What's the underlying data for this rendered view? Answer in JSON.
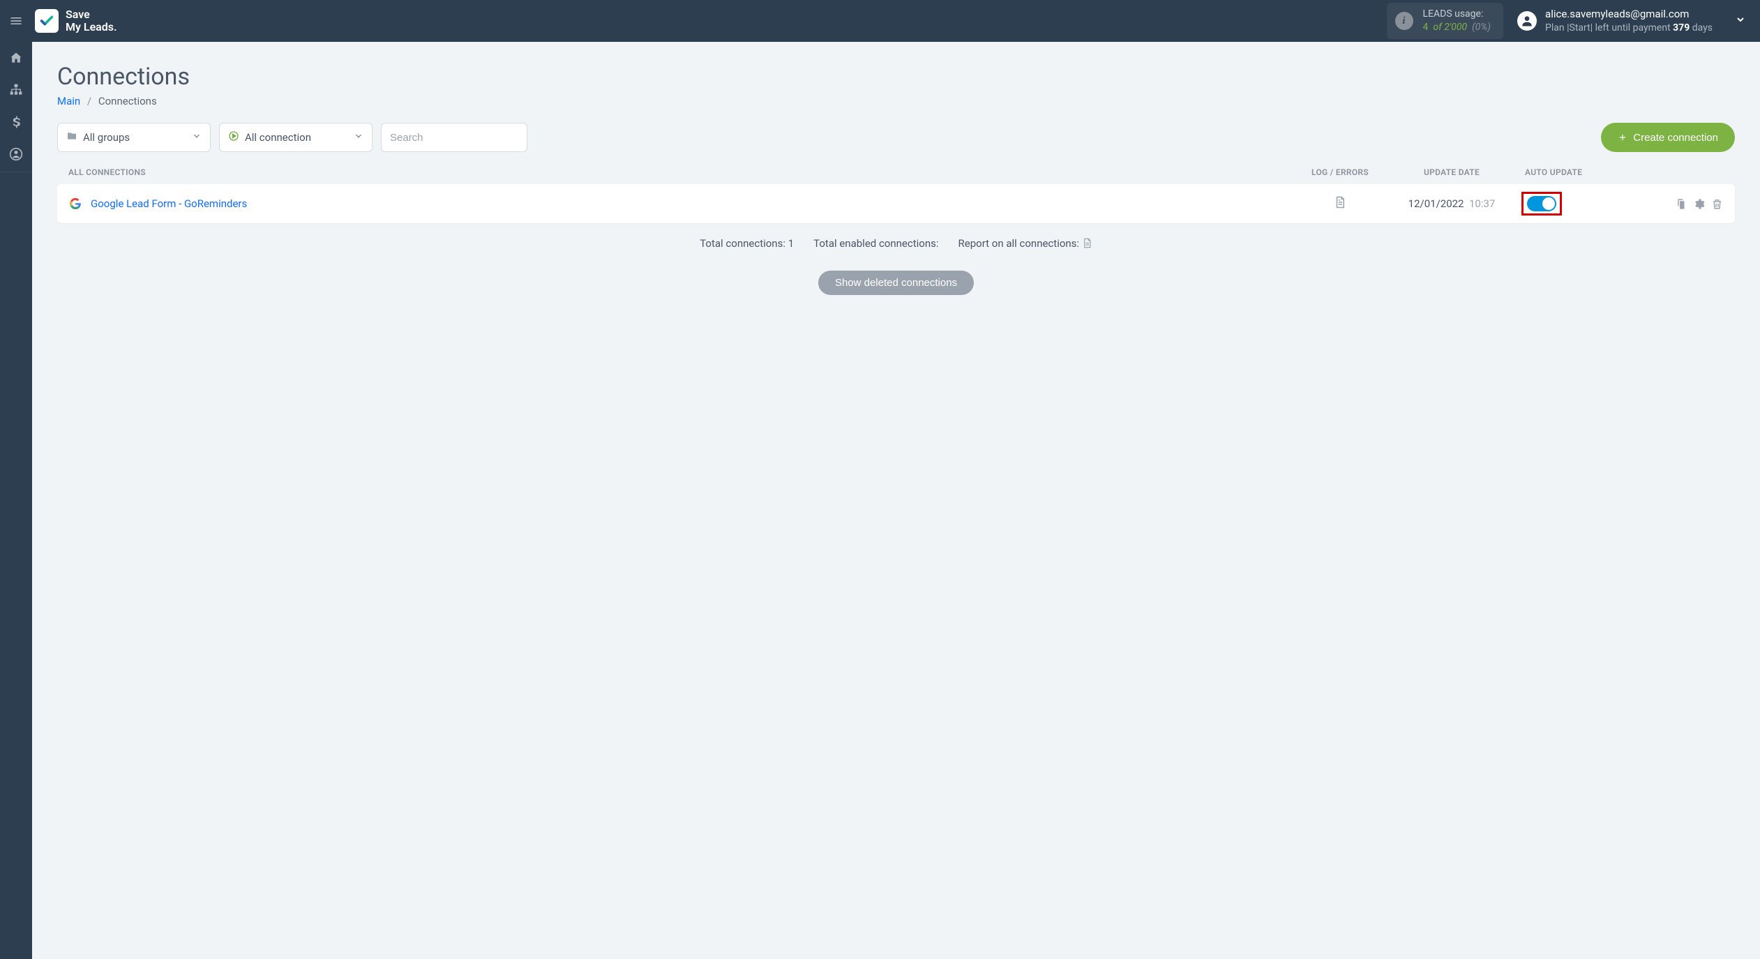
{
  "brand": {
    "line1": "Save",
    "line2": "My Leads."
  },
  "usage": {
    "label": "LEADS usage:",
    "count": "4",
    "of": "of",
    "limit": "2'000",
    "pct": "(0%)"
  },
  "account": {
    "email": "alice.savemyleads@gmail.com",
    "plan_prefix": "Plan |Start| left until payment",
    "days_num": "379",
    "days_suffix": "days"
  },
  "page": {
    "title": "Connections",
    "breadcrumb_main": "Main",
    "breadcrumb_current": "Connections"
  },
  "filters": {
    "groups": "All groups",
    "status": "All connection",
    "search_placeholder": "Search",
    "create_label": "Create connection"
  },
  "columns": {
    "name": "ALL CONNECTIONS",
    "log": "LOG / ERRORS",
    "date": "UPDATE DATE",
    "auto": "AUTO UPDATE"
  },
  "connections": [
    {
      "name": "Google Lead Form - GoReminders",
      "date": "12/01/2022",
      "time": "10:37",
      "enabled": true
    }
  ],
  "summary": {
    "total_label": "Total connections:",
    "total_value": "1",
    "enabled_label": "Total enabled connections:",
    "report_label": "Report on all connections:"
  },
  "show_deleted": "Show deleted connections"
}
